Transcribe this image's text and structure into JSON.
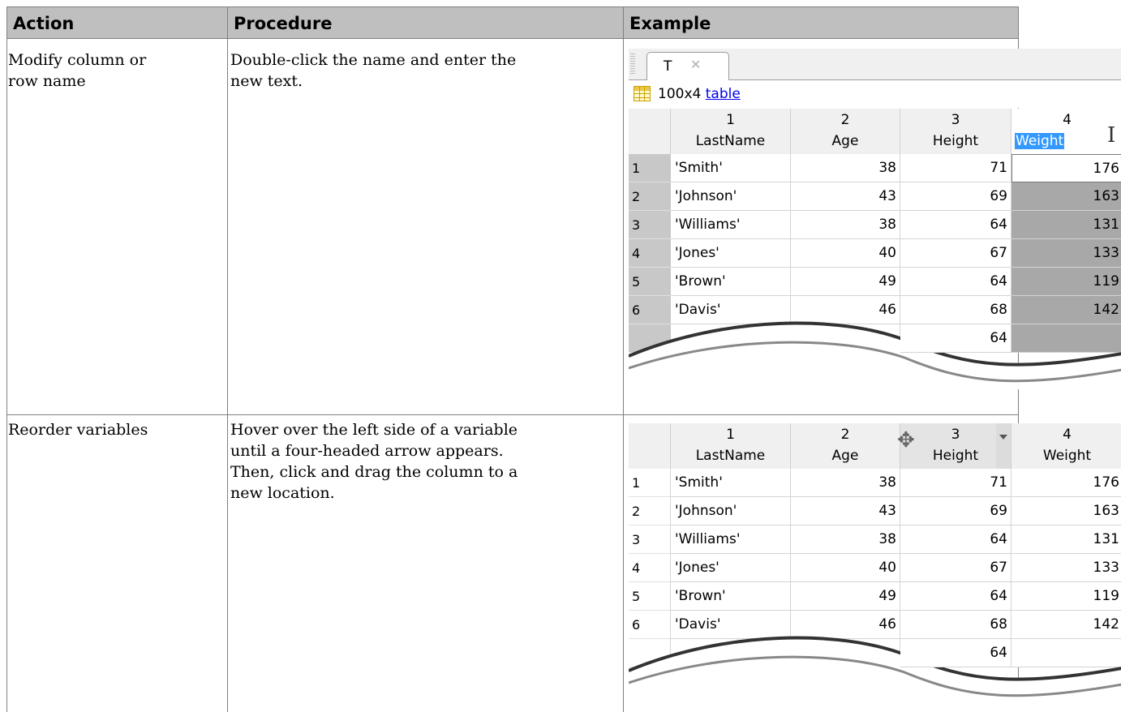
{
  "header": {
    "action": "Action",
    "procedure": "Procedure",
    "example": "Example"
  },
  "rows": [
    {
      "action": [
        "Modify column or",
        "row name"
      ],
      "procedure": [
        "Double-click the name and enter the",
        "new text."
      ]
    },
    {
      "action": [
        "Reorder variables"
      ],
      "procedure": [
        "Hover over the left side of a variable",
        "until a four-headed arrow appears.",
        "Then, click and drag the column to a",
        "new location."
      ]
    }
  ],
  "example1": {
    "tab_label": "T",
    "tab_close": "✕",
    "size_text": "100x4",
    "size_link": "table",
    "columns": [
      {
        "num": "1",
        "name": "LastName"
      },
      {
        "num": "2",
        "name": "Age"
      },
      {
        "num": "3",
        "name": "Height"
      },
      {
        "num": "4",
        "name": "Weight"
      }
    ],
    "rows": [
      {
        "idx": "1",
        "name": "'Smith'",
        "age": "38",
        "height": "71",
        "weight": "176"
      },
      {
        "idx": "2",
        "name": "'Johnson'",
        "age": "43",
        "height": "69",
        "weight": "163"
      },
      {
        "idx": "3",
        "name": "'Williams'",
        "age": "38",
        "height": "64",
        "weight": "131"
      },
      {
        "idx": "4",
        "name": "'Jones'",
        "age": "40",
        "height": "67",
        "weight": "133"
      },
      {
        "idx": "5",
        "name": "'Brown'",
        "age": "49",
        "height": "64",
        "weight": "119"
      },
      {
        "idx": "6",
        "name": "'Davis'",
        "age": "46",
        "height": "68",
        "weight": "142"
      }
    ],
    "extra_height": "64"
  },
  "example2": {
    "columns": [
      {
        "num": "1",
        "name": "LastName"
      },
      {
        "num": "2",
        "name": "Age"
      },
      {
        "num": "3",
        "name": "Height"
      },
      {
        "num": "4",
        "name": "Weight"
      }
    ],
    "rows": [
      {
        "idx": "1",
        "name": "'Smith'",
        "age": "38",
        "height": "71",
        "weight": "176"
      },
      {
        "idx": "2",
        "name": "'Johnson'",
        "age": "43",
        "height": "69",
        "weight": "163"
      },
      {
        "idx": "3",
        "name": "'Williams'",
        "age": "38",
        "height": "64",
        "weight": "131"
      },
      {
        "idx": "4",
        "name": "'Jones'",
        "age": "40",
        "height": "67",
        "weight": "133"
      },
      {
        "idx": "5",
        "name": "'Brown'",
        "age": "49",
        "height": "64",
        "weight": "119"
      },
      {
        "idx": "6",
        "name": "'Davis'",
        "age": "46",
        "height": "68",
        "weight": "142"
      }
    ],
    "extra_height": "64"
  },
  "colors": {
    "header_bg": "#bfbfbf",
    "selection": "#3399ff",
    "link": "#0000ee"
  }
}
